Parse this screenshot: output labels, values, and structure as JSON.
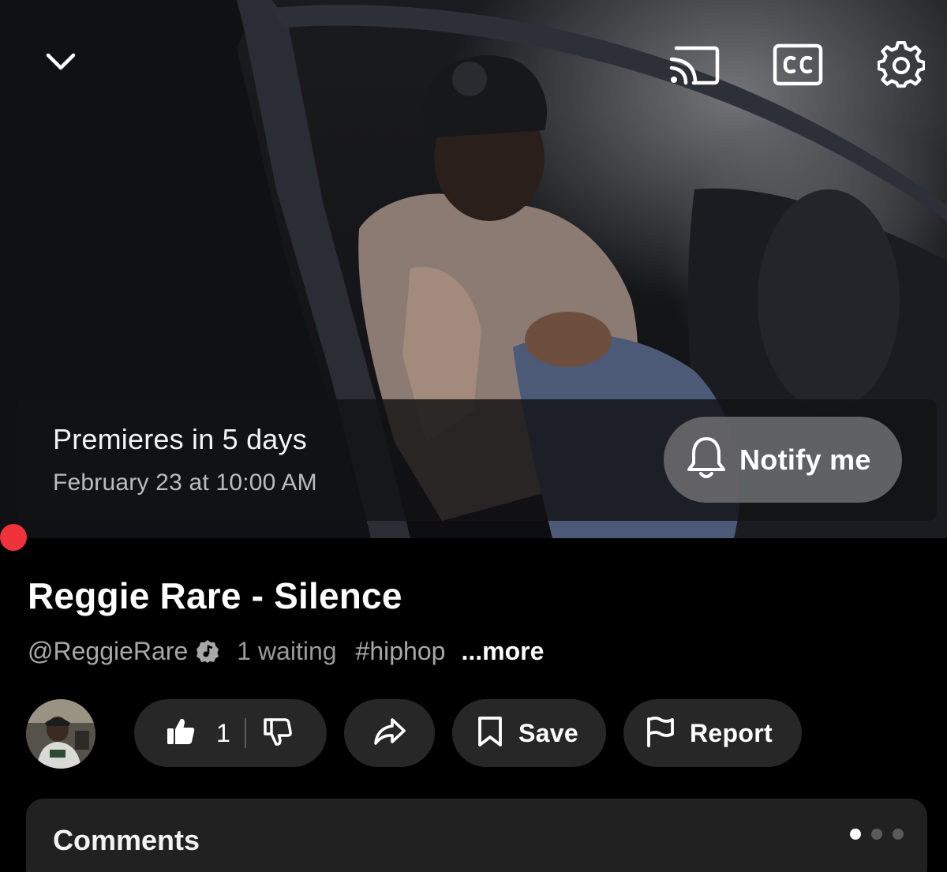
{
  "player": {
    "premiere_title": "Premieres in 5 days",
    "premiere_date": "February 23 at 10:00 AM",
    "notify_label": "Notify me",
    "progress_color": "#f0333a",
    "icons": [
      "chevron-down-icon",
      "cast-icon",
      "closed-captions-icon",
      "settings-gear-icon",
      "bell-icon"
    ]
  },
  "video": {
    "title": "Reggie Rare - Silence",
    "channel_handle": "@ReggieRare",
    "waiting": "1 waiting",
    "hashtag": "#hiphop",
    "more_label": "...more"
  },
  "actions": {
    "like_count": "1",
    "save_label": "Save",
    "report_label": "Report"
  },
  "comments": {
    "title": "Comments",
    "page_count": 3,
    "active_page": 1
  },
  "colors": {
    "background": "#000000",
    "pill": "#272727",
    "card": "#212121",
    "accent_red": "#f0333a"
  }
}
